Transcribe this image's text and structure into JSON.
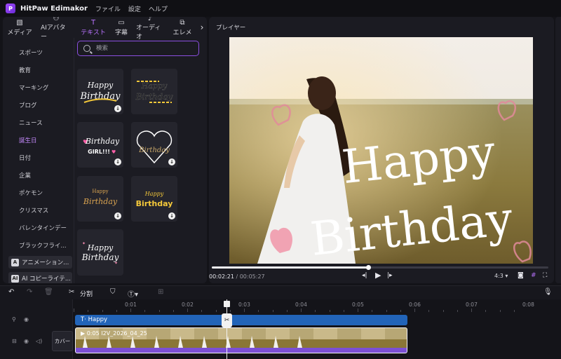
{
  "app": {
    "title": "HitPaw Edimakor",
    "menu": [
      "ファイル",
      "設定",
      "ヘルプ"
    ]
  },
  "left_panel": {
    "tabs": [
      {
        "label": "メディア",
        "icon": "media-icon"
      },
      {
        "label": "AIアバター",
        "icon": "avatar-icon"
      },
      {
        "label": "テキスト",
        "icon": "text-icon",
        "active": true
      },
      {
        "label": "字幕",
        "icon": "subtitle-icon"
      },
      {
        "label": "オーディオ",
        "icon": "audio-icon"
      },
      {
        "label": "エレメ",
        "icon": "element-icon"
      }
    ],
    "categories": [
      "スポーツ",
      "教育",
      "マーキング",
      "ブログ",
      "ニュース",
      "誕生日",
      "日付",
      "企業",
      "ポケモン",
      "クリスマス",
      "バレンタインデー",
      "ブラックフライ..."
    ],
    "active_category": "誕生日",
    "special_categories": [
      {
        "label": "アニメーション...",
        "icon": "A"
      },
      {
        "label": "AI コピーライテ...",
        "icon": "AI"
      }
    ],
    "search": {
      "placeholder": "検索"
    },
    "templates": [
      {
        "line1": "Happy",
        "line2": "Birthday"
      },
      {
        "line1": "Happy",
        "line2": "Birthday"
      },
      {
        "line1": "Birthday",
        "line2": "GIRL!!!"
      },
      {
        "line1": "Birthday",
        "line2": ""
      },
      {
        "line1": "Happy",
        "line2": "Birthday"
      },
      {
        "line1": "Happy",
        "line2": "Birthday"
      },
      {
        "line1": "Happy",
        "line2": "Birthday"
      }
    ]
  },
  "player": {
    "title": "プレイヤー",
    "overlay_text": {
      "line1": "Happy",
      "line2": "Birthday"
    },
    "time_current": "00:02:21",
    "time_separator": " / ",
    "time_total": "00:05:27",
    "progress_fraction": 0.465,
    "aspect_ratio": "4:3"
  },
  "timeline": {
    "toolbar": {
      "split_label": "分割"
    },
    "ruler_ticks": [
      "0:01",
      "0:02",
      "0:03",
      "0:04",
      "0:05",
      "0:06",
      "0:07",
      "0:08"
    ],
    "text_clip_label": "Happy",
    "video_clip_info": "0:05 I2V_2026_04_25",
    "cover_label": "カバー",
    "playhead_time_fraction": 0.4
  },
  "colors": {
    "accent": "#b973ff",
    "text_clip": "#2264b8",
    "video_clip_bottom": "#7b4fd4",
    "search_border": "#8b4fe0"
  }
}
